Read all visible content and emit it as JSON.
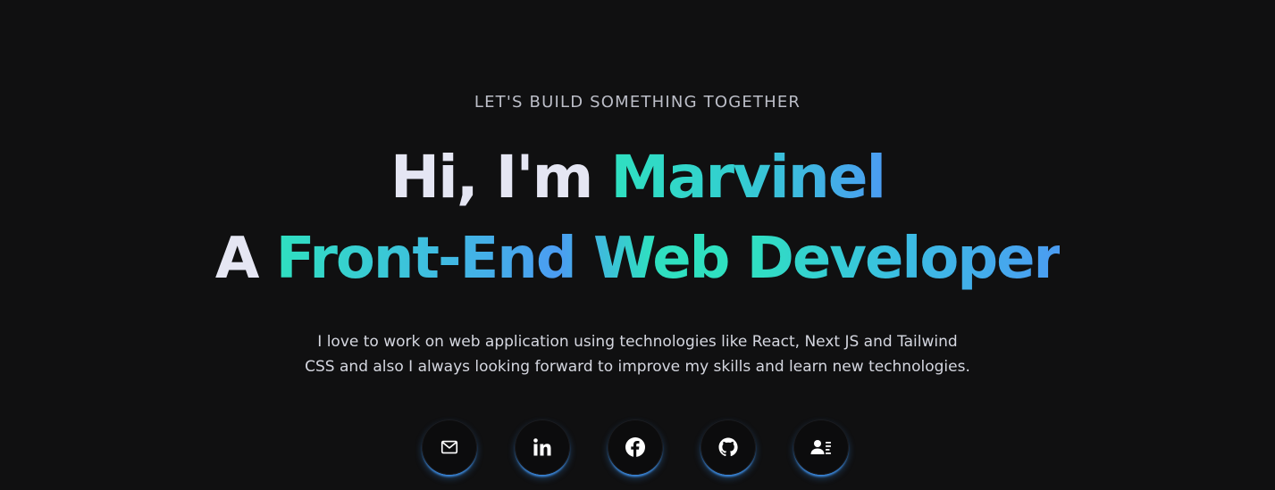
{
  "hero": {
    "eyebrow": "LET'S BUILD SOMETHING TOGETHER",
    "greeting_prefix": "Hi, I'm ",
    "name": "Marvinel",
    "role_prefix": "A ",
    "role": "Front-End Web Developer",
    "description_line1": "I love to work on web application using technologies like React, Next JS and Tailwind",
    "description_line2": "CSS and also I always looking forward to improve my skills and learn new technologies."
  },
  "socials": [
    {
      "icon": "mail-icon"
    },
    {
      "icon": "linkedin-icon"
    },
    {
      "icon": "facebook-icon"
    },
    {
      "icon": "github-icon"
    },
    {
      "icon": "contact-card-icon"
    }
  ],
  "colors": {
    "background": "#101011",
    "accent_teal": "#2fe0c0",
    "accent_blue": "#4b9cf2",
    "text_primary": "#e5e6f3"
  }
}
